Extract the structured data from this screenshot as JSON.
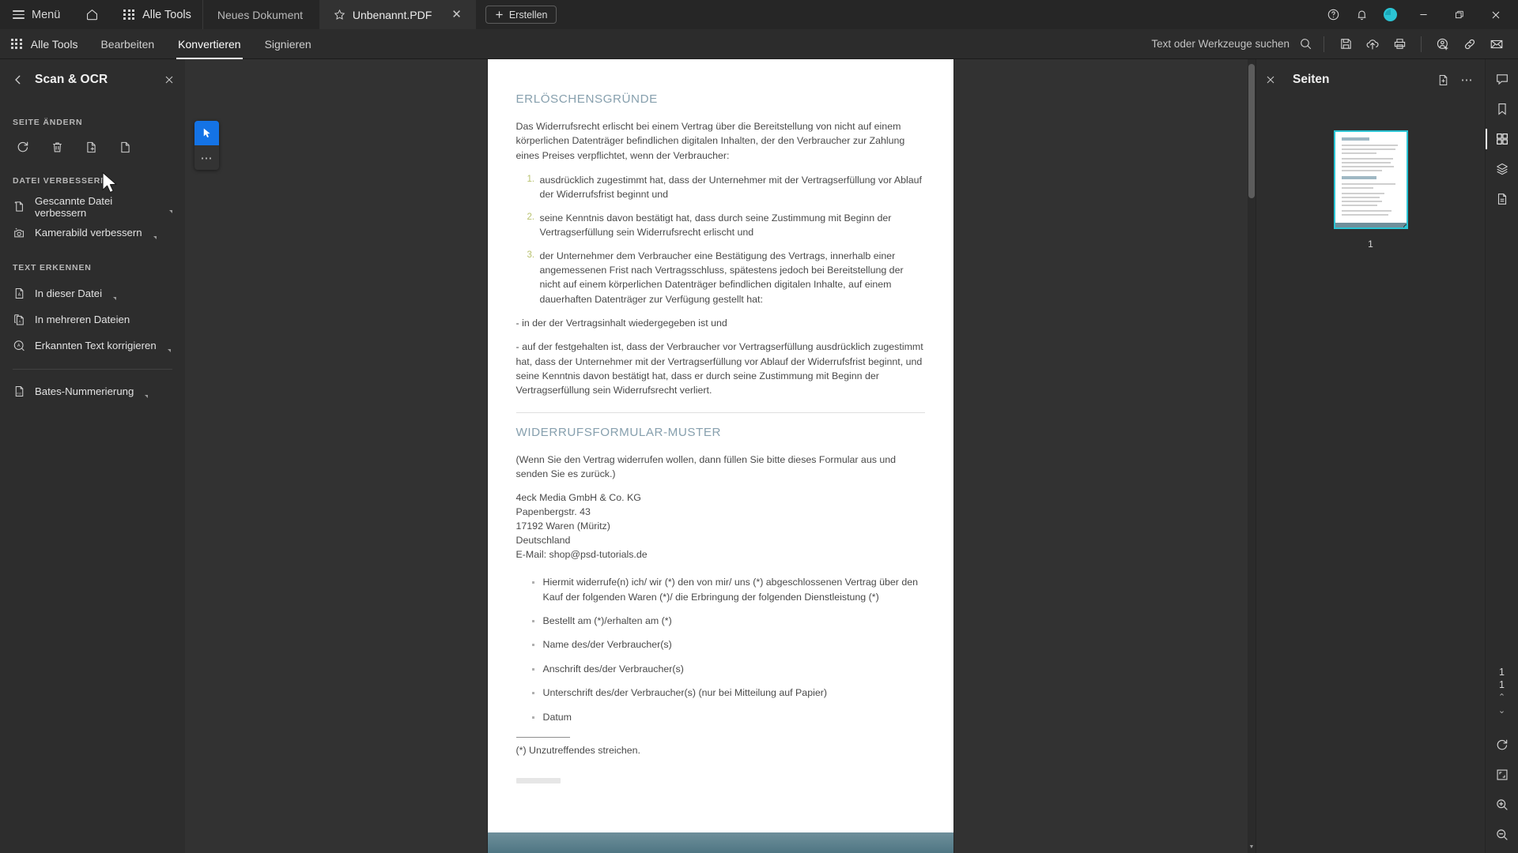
{
  "titlebar": {
    "menu_label": "Menü",
    "home_icon": "home-icon",
    "all_tools_label": "Alle Tools",
    "tabs": [
      {
        "label": "Neues Dokument",
        "active": false,
        "starred": false
      },
      {
        "label": "Unbenannt.PDF",
        "active": true,
        "starred": true,
        "close": "✕"
      }
    ],
    "create_label": "Erstellen",
    "create_icon": "plus-icon",
    "help_icon": "help-circle-icon",
    "bell_icon": "bell-icon",
    "avatar": "user-avatar",
    "avatar_color": "#2bc4d4",
    "minimize": "–",
    "restore": "restore-window-icon",
    "close": "✕"
  },
  "toolbar": {
    "all_tools_label": "Alle Tools",
    "menu_tabs": [
      {
        "label": "Bearbeiten",
        "active": false
      },
      {
        "label": "Konvertieren",
        "active": true
      },
      {
        "label": "Signieren",
        "active": false
      }
    ],
    "search_placeholder": "Text oder Werkzeuge suchen",
    "icons": [
      "search-icon",
      "save-icon",
      "upload-cloud-icon",
      "print-icon",
      "add-user-icon",
      "link-icon",
      "mail-icon"
    ]
  },
  "left_panel": {
    "back_icon": "chevron-left-icon",
    "title": "Scan & OCR",
    "close_icon": "close-icon",
    "sections": [
      {
        "heading": "SEITE ÄNDERN",
        "type": "icons",
        "icons": [
          {
            "name": "rotate-page-icon"
          },
          {
            "name": "delete-page-icon"
          },
          {
            "name": "extract-page-icon"
          },
          {
            "name": "replace-page-icon"
          }
        ]
      },
      {
        "heading": "DATEI VERBESSERN",
        "type": "items",
        "items": [
          {
            "label": "Gescannte Datei verbessern",
            "icon": "enhance-scan-icon",
            "caret": true
          },
          {
            "label": "Kamerabild verbessern",
            "icon": "camera-enhance-icon",
            "caret": true
          }
        ]
      },
      {
        "heading": "TEXT ERKENNEN",
        "type": "items",
        "items": [
          {
            "label": "In dieser Datei",
            "icon": "ocr-file-icon",
            "caret": true
          },
          {
            "label": "In mehreren Dateien",
            "icon": "ocr-multi-file-icon",
            "caret": false
          },
          {
            "label": "Erkannten Text korrigieren",
            "icon": "correct-text-icon",
            "caret": true
          }
        ]
      },
      {
        "heading": "",
        "type": "items",
        "items": [
          {
            "label": "Bates-Nummerierung",
            "icon": "bates-numbering-icon",
            "caret": true
          }
        ]
      }
    ]
  },
  "tool_strip": {
    "buttons": [
      {
        "name": "select-tool",
        "selected": true
      },
      {
        "name": "more-options",
        "selected": false,
        "glyph": "⋯"
      }
    ]
  },
  "document": {
    "heading1": "ERLÖSCHENSGRÜNDE",
    "paragraph1": "Das Widerrufsrecht erlischt bei einem Vertrag über die Bereitstellung von nicht auf einem körperlichen Datenträger befindlichen digitalen Inhalten, der den Verbraucher zur Zahlung eines Preises verpflichtet, wenn der Verbraucher:",
    "numbered_list": [
      "ausdrücklich zugestimmt hat, dass der Unternehmer mit der Vertragserfüllung vor Ablauf der Widerrufsfrist beginnt und",
      "seine Kenntnis davon bestätigt hat, dass durch seine Zustimmung mit Beginn der Vertragserfüllung sein Widerrufsrecht erlischt und",
      "der Unternehmer dem Verbraucher eine Bestätigung des Vertrags, innerhalb einer angemessenen Frist nach Vertragsschluss, spätestens jedoch bei Bereitstellung der nicht auf einem körperlichen Datenträger befindlichen digitalen Inhalte, auf einem dauerhaften Datenträger zur Verfügung gestellt hat:"
    ],
    "dash1": "- in der der Vertragsinhalt wiedergegeben ist und",
    "dash2": "- auf der festgehalten ist, dass der Verbraucher vor Vertragserfüllung ausdrücklich zugestimmt hat, dass der Unternehmer mit der Vertragserfüllung vor Ablauf der Widerrufsfrist beginnt, und seine Kenntnis davon bestätigt hat, dass er durch seine Zustimmung mit Beginn der Vertragserfüllung sein Widerrufsrecht verliert.",
    "heading2": "WIDERRUFSFORMULAR-MUSTER",
    "paragraph2": "(Wenn Sie den Vertrag widerrufen wollen, dann füllen Sie bitte dieses Formular aus und senden Sie es zurück.)",
    "address": [
      "4eck Media GmbH & Co. KG",
      "Papenbergstr. 43",
      "17192 Waren (Müritz)",
      "Deutschland",
      "E-Mail: shop@psd-tutorials.de"
    ],
    "bullets": [
      "Hiermit widerrufe(n) ich/ wir (*) den von mir/ uns (*) abgeschlossenen Vertrag über den Kauf der folgenden Waren (*)/ die Erbringung der folgenden Dienstleistung (*)",
      "Bestellt am (*)/erhalten am (*)",
      "Name des/der Verbraucher(s)",
      "Anschrift des/der Verbraucher(s)",
      "Unterschrift des/der Verbraucher(s) (nur bei Mitteilung auf Papier)",
      "Datum"
    ],
    "footnote": "(*) Unzutreffendes streichen."
  },
  "pages_panel": {
    "close_icon": "close-icon",
    "title": "Seiten",
    "actions": [
      {
        "name": "insert-page-icon"
      },
      {
        "name": "more-options-icon",
        "glyph": "⋯"
      }
    ],
    "thumbnails": [
      {
        "page_number": "1",
        "selected": true
      }
    ]
  },
  "right_rail": {
    "top_icons": [
      {
        "name": "comment-icon",
        "active": false
      },
      {
        "name": "bookmark-icon",
        "active": false
      },
      {
        "name": "page-thumbnails-icon",
        "active": true
      },
      {
        "name": "layers-icon",
        "active": false
      },
      {
        "name": "attachments-icon",
        "active": false
      }
    ],
    "page_current": "1",
    "page_total": "1",
    "nav_up": "⌃",
    "nav_down": "⌄",
    "bottom_icons": [
      {
        "name": "rotate-view-icon"
      },
      {
        "name": "fit-page-icon"
      },
      {
        "name": "zoom-in-icon"
      },
      {
        "name": "zoom-out-icon"
      }
    ]
  }
}
